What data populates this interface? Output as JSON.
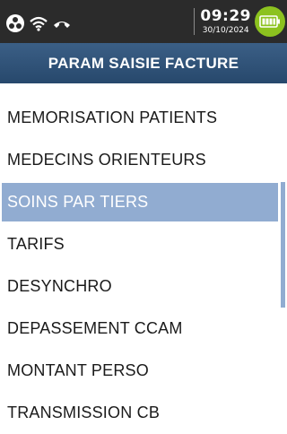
{
  "status_bar": {
    "icons": [
      "network-icon",
      "wifi-icon",
      "phone-icon"
    ],
    "time": "09:29",
    "date": "30/10/2024",
    "battery_icon": "battery-icon"
  },
  "header": {
    "title": "PARAM SAISIE FACTURE"
  },
  "menu": {
    "items": [
      {
        "label": "MEMORISATION PATIENTS",
        "selected": false
      },
      {
        "label": "MEDECINS ORIENTEURS",
        "selected": false
      },
      {
        "label": "SOINS PAR TIERS",
        "selected": true
      },
      {
        "label": "TARIFS",
        "selected": false
      },
      {
        "label": "DESYNCHRO",
        "selected": false
      },
      {
        "label": "DEPASSEMENT CCAM",
        "selected": false
      },
      {
        "label": "MONTANT PERSO",
        "selected": false
      },
      {
        "label": "TRANSMISSION CB",
        "selected": false
      }
    ]
  },
  "colors": {
    "status_bar_bg": "#2b2b2b",
    "title_bar_bg": "#2f5479",
    "selection_bg": "#91acd1",
    "battery_green": "#8cc21f"
  }
}
